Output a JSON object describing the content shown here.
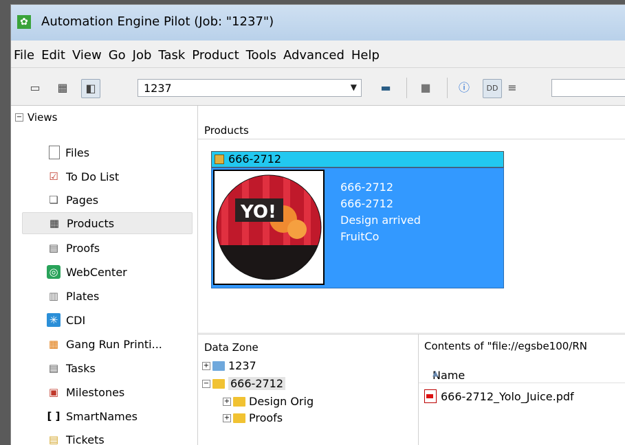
{
  "window": {
    "title": "Automation Engine Pilot (Job: \"1237\")"
  },
  "menu": [
    "File",
    "Edit",
    "View",
    "Go",
    "Job",
    "Task",
    "Product",
    "Tools",
    "Advanced",
    "Help"
  ],
  "toolbar": {
    "job_combo_value": "1237",
    "search_value": ""
  },
  "views": {
    "header": "Views",
    "items": [
      {
        "label": "Files",
        "icon": "file-icon"
      },
      {
        "label": "To Do List",
        "icon": "todo-icon"
      },
      {
        "label": "Pages",
        "icon": "pages-icon"
      },
      {
        "label": "Products",
        "icon": "products-icon",
        "selected": true
      },
      {
        "label": "Proofs",
        "icon": "proofs-icon"
      },
      {
        "label": "WebCenter",
        "icon": "webcenter-icon"
      },
      {
        "label": "Plates",
        "icon": "plates-icon"
      },
      {
        "label": "CDI",
        "icon": "cdi-icon"
      },
      {
        "label": "Gang Run Printi...",
        "icon": "gang-run-icon"
      },
      {
        "label": "Tasks",
        "icon": "tasks-icon"
      },
      {
        "label": "Milestones",
        "icon": "milestones-icon"
      },
      {
        "label": "SmartNames",
        "icon": "smartnames-icon"
      },
      {
        "label": "Tickets",
        "icon": "tickets-icon"
      }
    ]
  },
  "products": {
    "header": "Products",
    "card": {
      "title": "666-2712",
      "lines": [
        "666-2712",
        "666-2712",
        "Design arrived",
        "FruitCo"
      ],
      "thumb_text": "YO!"
    }
  },
  "datazone": {
    "header": "Data Zone",
    "tree": [
      {
        "label": "1237",
        "expander": "+"
      },
      {
        "label": "666-2712",
        "expander": "−"
      },
      {
        "label": "Design Orig",
        "expander": "+"
      },
      {
        "label": "Proofs",
        "expander": "+"
      }
    ]
  },
  "contents": {
    "title": "Contents of \"file://egsbe100/RN",
    "column_name": "Name",
    "files": [
      "666-2712_Yolo_Juice.pdf"
    ]
  },
  "colors": {
    "selection": "#3399ff",
    "card_header": "#22c8f0",
    "title_bar": "#c2d7ee"
  }
}
